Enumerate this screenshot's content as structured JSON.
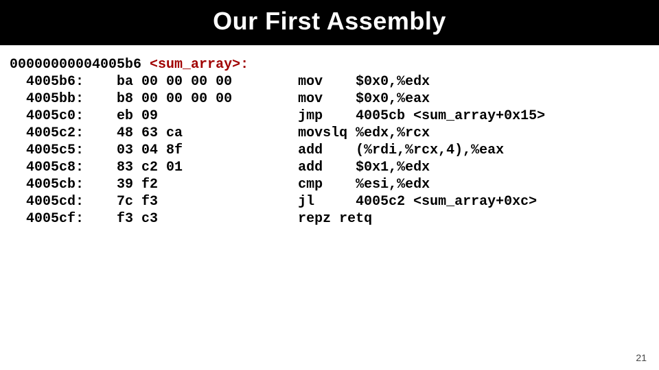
{
  "title": "Our First Assembly",
  "page_number": "21",
  "code": {
    "header_addr": "00000000004005b6",
    "header_sym": "<sum_array>:",
    "rows": [
      {
        "addr": "4005b6:",
        "bytes": "ba 00 00 00 00",
        "mnemonic": "mov",
        "operands": "$0x0,%edx"
      },
      {
        "addr": "4005bb:",
        "bytes": "b8 00 00 00 00",
        "mnemonic": "mov",
        "operands": "$0x0,%eax"
      },
      {
        "addr": "4005c0:",
        "bytes": "eb 09",
        "mnemonic": "jmp",
        "operands": "4005cb <sum_array+0x15>"
      },
      {
        "addr": "4005c2:",
        "bytes": "48 63 ca",
        "mnemonic": "movslq",
        "operands": "%edx,%rcx"
      },
      {
        "addr": "4005c5:",
        "bytes": "03 04 8f",
        "mnemonic": "add",
        "operands": "(%rdi,%rcx,4),%eax"
      },
      {
        "addr": "4005c8:",
        "bytes": "83 c2 01",
        "mnemonic": "add",
        "operands": "$0x1,%edx"
      },
      {
        "addr": "4005cb:",
        "bytes": "39 f2",
        "mnemonic": "cmp",
        "operands": "%esi,%edx"
      },
      {
        "addr": "4005cd:",
        "bytes": "7c f3",
        "mnemonic": "jl",
        "operands": "4005c2 <sum_array+0xc>"
      },
      {
        "addr": "4005cf:",
        "bytes": "f3 c3",
        "mnemonic": "repz retq",
        "operands": ""
      }
    ]
  }
}
